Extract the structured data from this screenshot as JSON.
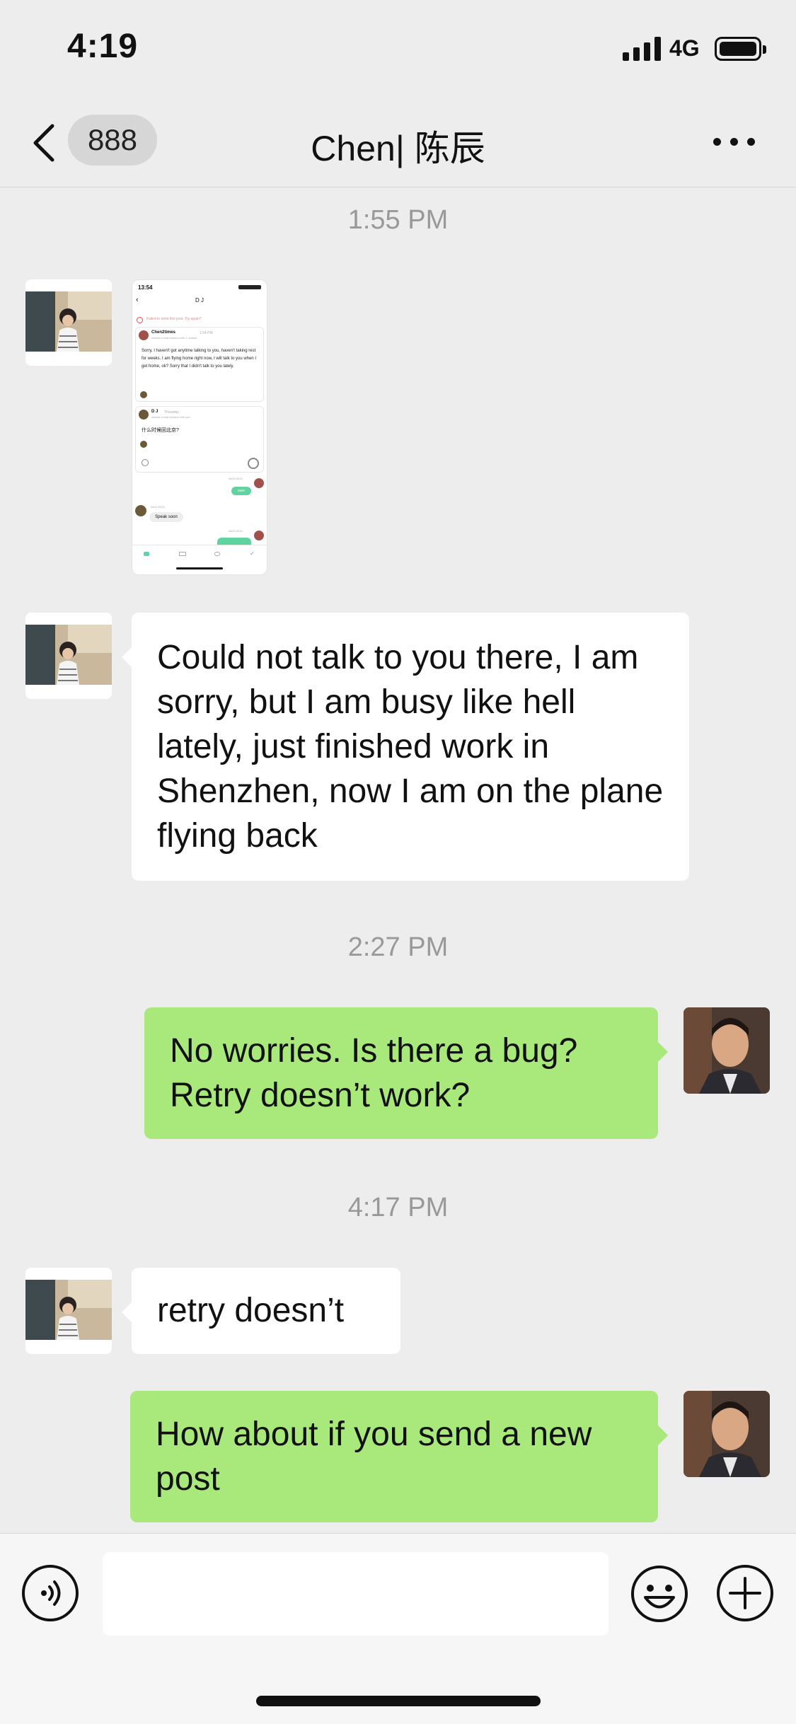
{
  "status_bar": {
    "time": "4:19",
    "network": "4G"
  },
  "nav": {
    "badge_count": "888",
    "title": "Chen| 陈辰"
  },
  "messages": [
    {
      "type": "timestamp",
      "text": "1:55 PM"
    },
    {
      "type": "image",
      "from": "Chen",
      "screenshot": {
        "time": "13:54",
        "header_title": "D J",
        "error": "Failed to send this post. Try again?",
        "post1_author": "Chen2times",
        "post1_time": "1:54 PM",
        "post1_sub": "shared a chat session with 1 contact",
        "post1_text": "Sorry, I haven't got anytime talking to you, haven't taking rest for weeks. I am flying home right now, I will talk to you when I get home, ok? Sorry that I didn't talk to you lately.",
        "post2_author": "D J",
        "post2_time": "Thursday",
        "post2_sub": "shared a chat session with you",
        "post2_text": "什么时候回北京?",
        "date1": "08/11/2019",
        "sent_bubble": "sure",
        "date2": "08/11/2019",
        "recv_bubble": "Speak soon",
        "date3": "08/11/2019"
      }
    },
    {
      "type": "text",
      "from": "Chen",
      "text": "Could not talk to you there, I am sorry, but I am busy like hell lately, just finished work in Shenzhen, now I am on the plane flying back"
    },
    {
      "type": "timestamp",
      "text": "2:27 PM"
    },
    {
      "type": "text",
      "from": "me",
      "text": "No worries.  Is there a bug? Retry doesn’t work?"
    },
    {
      "type": "timestamp",
      "text": "4:17 PM"
    },
    {
      "type": "text",
      "from": "Chen",
      "text": "retry doesn’t"
    },
    {
      "type": "text",
      "from": "me",
      "text": "How about if you send a new post"
    }
  ],
  "input_bar": {
    "placeholder": ""
  },
  "colors": {
    "background": "#ededed",
    "sent_bubble": "#a9e87a",
    "received_bubble": "#ffffff",
    "accent_green": "#5fd3a0"
  },
  "icons": [
    "back-chevron-icon",
    "more-icon",
    "voice-icon",
    "emoji-icon",
    "plus-icon"
  ]
}
